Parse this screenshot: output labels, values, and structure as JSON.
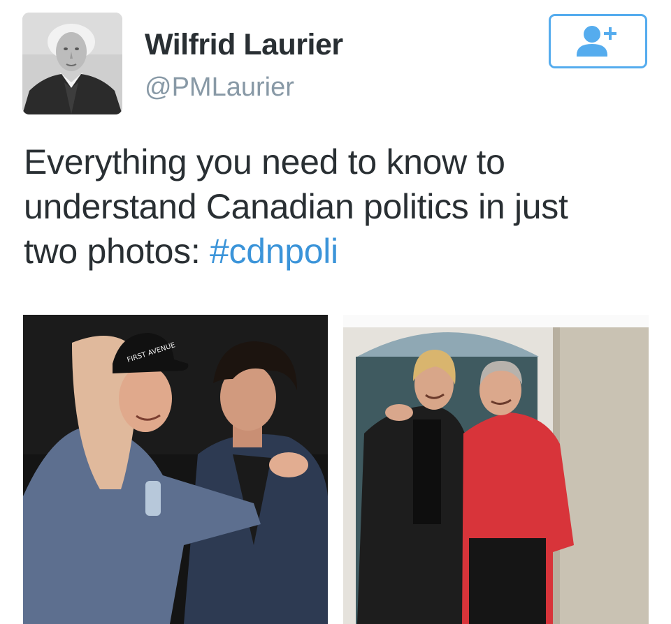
{
  "profile": {
    "display_name": "Wilfrid Laurier",
    "handle": "@PMLaurier",
    "avatar_icon": "portrait-photo"
  },
  "follow_button": {
    "icon": "follow-user-plus-icon",
    "color": "#55acee"
  },
  "tweet": {
    "text_line1": "Everything you need to know to",
    "text_line2": "understand Canadian politics in just",
    "text_line3_prefix": "two photos: ",
    "hashtag": "#cdnpoli",
    "text_color": "#292f33",
    "hashtag_color": "#3b94d9"
  },
  "media": {
    "photo_left_icon": "photo-two-men-greeting",
    "photo_right_icon": "photo-two-men-posing",
    "cap_lettering": "FIRST AVENUE"
  }
}
